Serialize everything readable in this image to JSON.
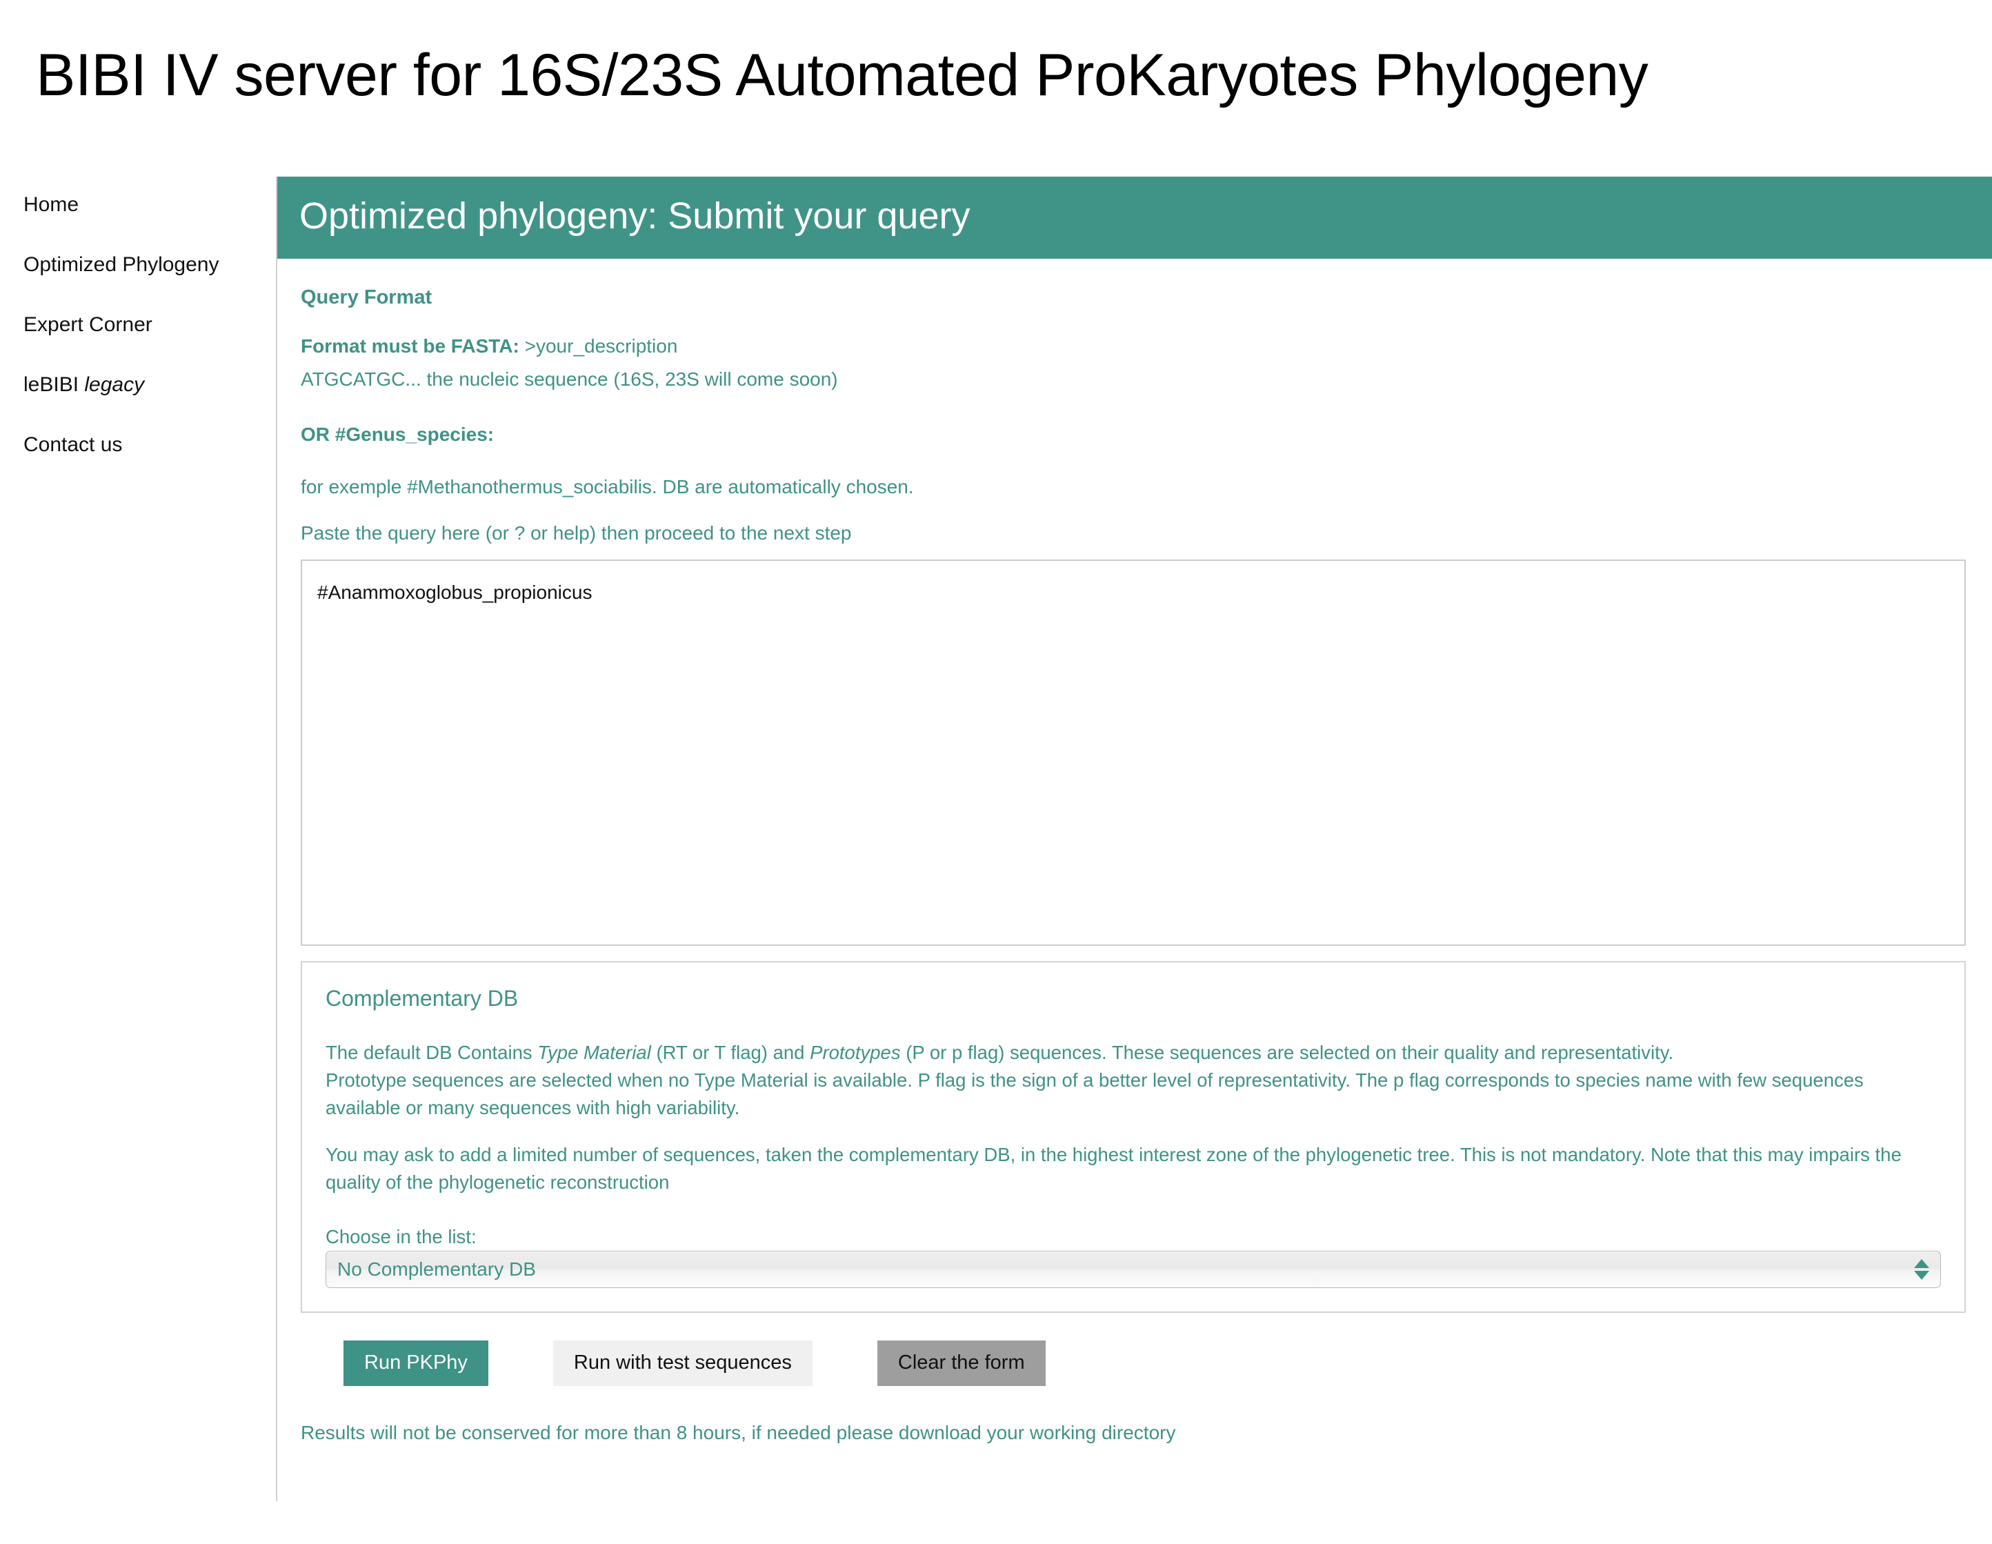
{
  "page": {
    "title": "BIBI IV server for 16S/23S Automated ProKaryotes Phylogeny"
  },
  "sidebar": {
    "items": [
      {
        "label": "Home"
      },
      {
        "label": "Optimized Phylogeny"
      },
      {
        "label": "Expert Corner"
      },
      {
        "label": "leBIBI ",
        "label_italic": "legacy"
      },
      {
        "label": "Contact us"
      }
    ]
  },
  "panel": {
    "header": "Optimized phylogeny: Submit your query",
    "query_format": {
      "heading": "Query Format",
      "fasta_label": "Format must be FASTA:",
      "fasta_example": " >your_description",
      "fasta_line2": "ATGCATGC... the nucleic sequence (16S, 23S will come soon)",
      "genus_heading": "OR #Genus_species:",
      "genus_example": "for exemple #Methanothermus_sociabilis. DB are automatically chosen.",
      "paste_hint": "Paste the query here (or ? or help) then proceed to the next step"
    },
    "textarea": {
      "value": "#Anammoxoglobus_propionicus",
      "placeholder": ""
    },
    "complementary_db": {
      "title": "Complementary DB",
      "p1_a": "The default DB Contains ",
      "p1_i1": "Type Material",
      "p1_b": " (RT or T flag) and ",
      "p1_i2": "Prototypes",
      "p1_c": " (P or p flag) sequences. These sequences are selected on their quality and representativity.",
      "p2": "Prototype sequences are selected when no Type Material is available. P flag is the sign of a better level of representativity. The p flag corresponds to species name with few sequences available or many sequences with high variability.",
      "p3": "You may ask to add a limited number of sequences, taken the complementary DB, in the highest interest zone of the phylogenetic tree. This is not mandatory. Note that this may impairs the quality of the phylogenetic reconstruction",
      "choose_label": "Choose in the list:",
      "select_value": "No Complementary DB",
      "select_options": [
        "No Complementary DB"
      ]
    },
    "buttons": {
      "run": "Run PKPhy",
      "test": "Run with test sequences",
      "clear": "Clear the form"
    },
    "footer_note": "Results will not be conserved for more than 8 hours, if needed please download your working directory"
  },
  "colors": {
    "teal": "#409487",
    "teal_text": "#3f9286",
    "clear_button_gray": "#9e9e9e",
    "test_button_gray": "#f0f0f0"
  }
}
